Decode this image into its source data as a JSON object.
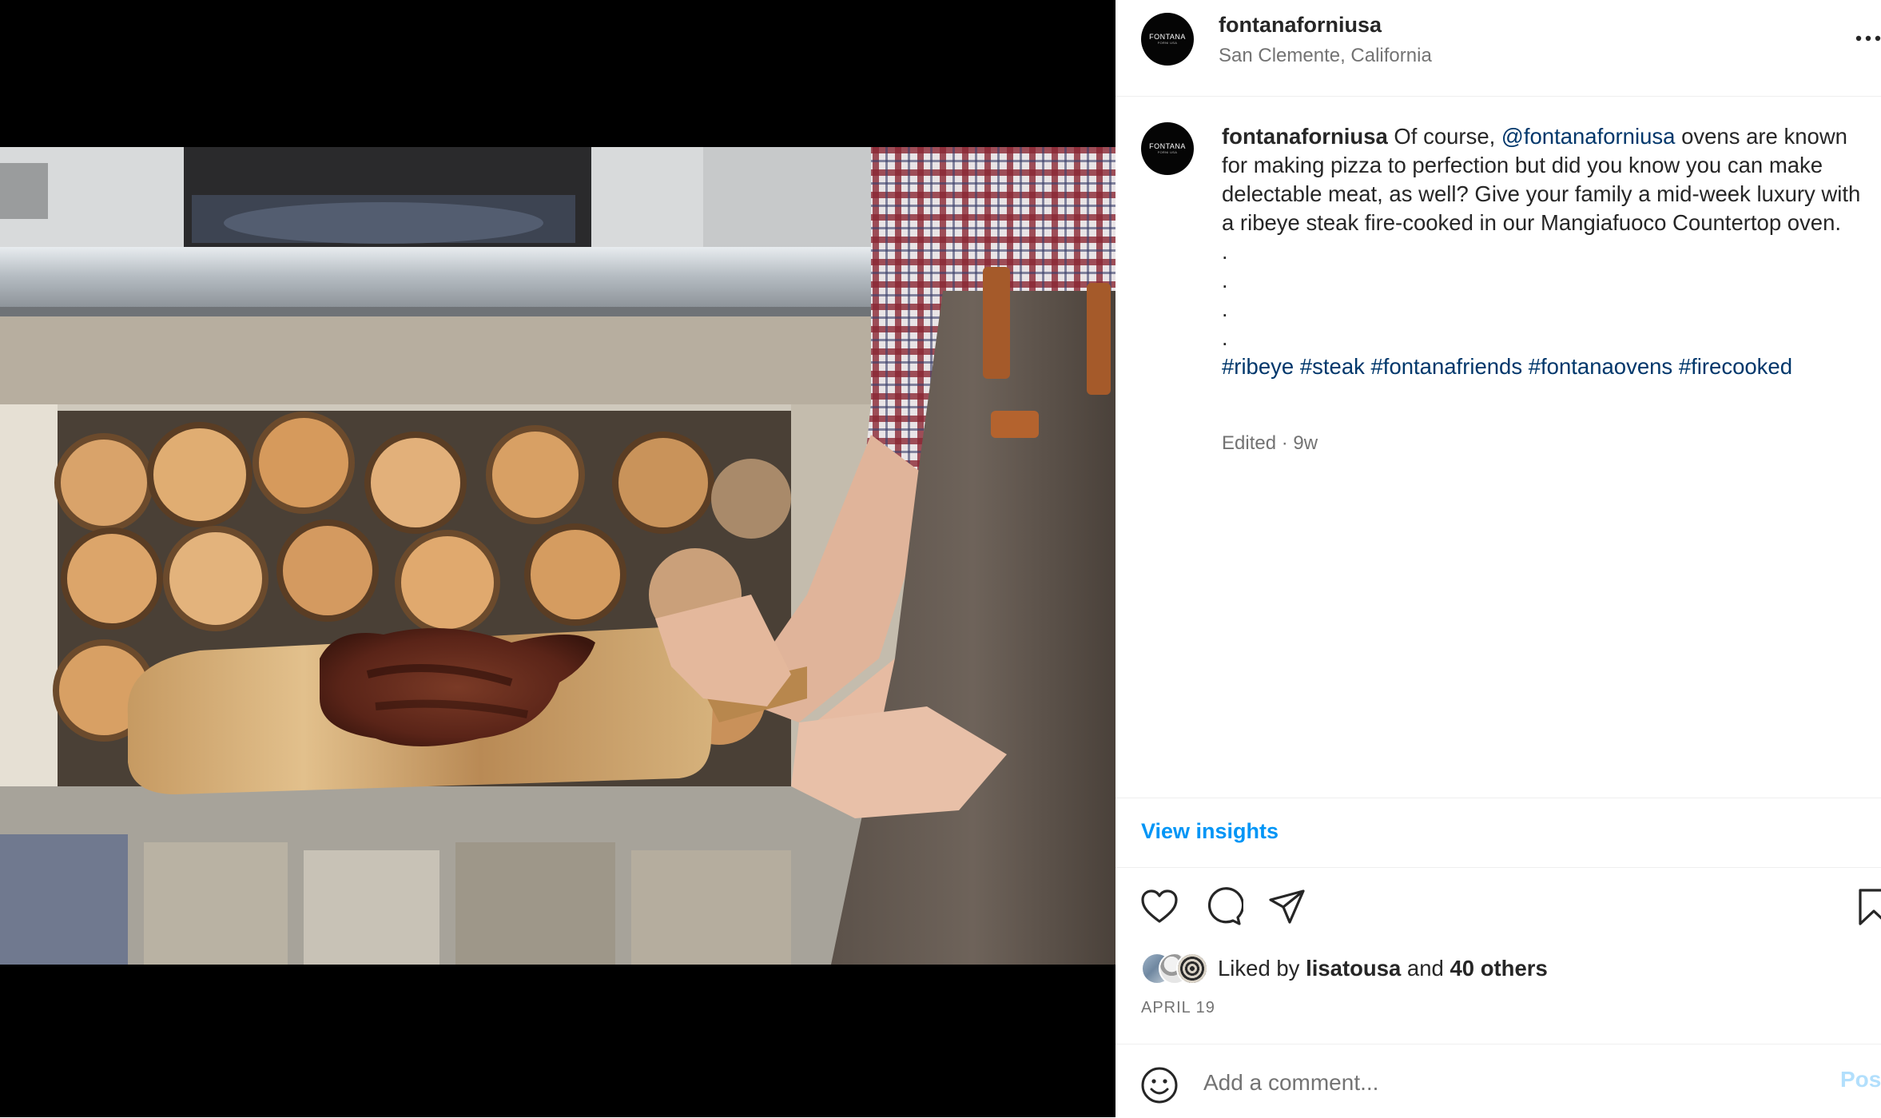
{
  "post": {
    "username": "fontanaforniusa",
    "location": "San Clemente, California",
    "avatar_logo": "FONTANA",
    "avatar_logo_sub": "FORNI USA",
    "more_icon": "more-horizontal-icon"
  },
  "caption": {
    "username": "fontanaforniusa",
    "text_before_mention": " Of course, ",
    "mention": "@fontanaforniusa",
    "text_after_mention": " ovens are known for making pizza to perfection but did you know you can make delectable meat, as well? Give your family a mid-week luxury with a ribeye steak fire-cooked in our Mangiafuoco Countertop oven.",
    "dots": [
      ".",
      ".",
      ".",
      "."
    ],
    "hashtags": [
      "#ribeye",
      "#steak",
      "#fontanafriends",
      "#fontanaovens",
      "#firecooked"
    ],
    "meta": "Edited · 9w"
  },
  "insights_label": "View insights",
  "actions": {
    "icons": [
      "heart-icon",
      "comment-icon",
      "share-icon",
      "bookmark-icon"
    ]
  },
  "likes": {
    "prefix": "Liked by ",
    "user": "lisatousa",
    "joiner": " and ",
    "others": "40 others"
  },
  "date": "APRIL 19",
  "comment_box": {
    "placeholder": "Add a comment...",
    "post_label": "Post",
    "emoji_icon": "emoji-icon"
  },
  "colors": {
    "link_blue": "#0095f6",
    "mention_blue": "#00376b",
    "post_disabled": "#b2dffc",
    "secondary_text": "#737373"
  }
}
